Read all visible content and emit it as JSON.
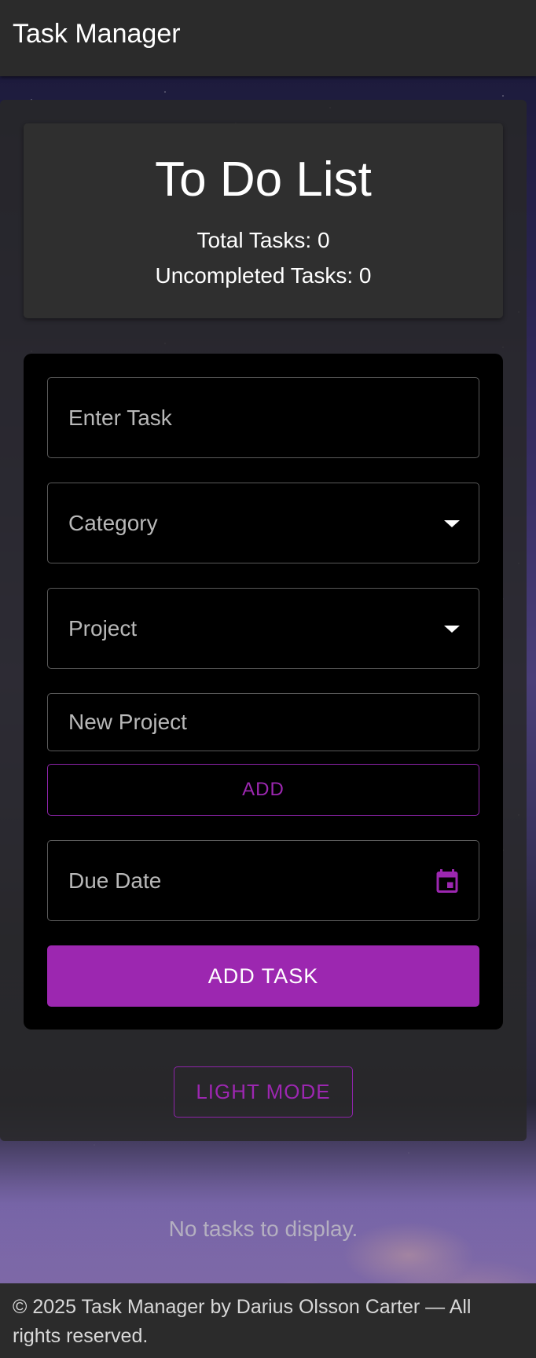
{
  "app": {
    "title": "Task Manager"
  },
  "header": {
    "title": "To Do List",
    "total_tasks": "Total Tasks: 0",
    "uncompleted_tasks": "Uncompleted Tasks: 0"
  },
  "form": {
    "task_placeholder": "Enter Task",
    "category_placeholder": "Category",
    "project_placeholder": "Project",
    "new_project_placeholder": "New Project",
    "add_label": "ADD",
    "due_date_placeholder": "Due Date",
    "add_task_label": "ADD TASK"
  },
  "theme_toggle": {
    "label": "LIGHT MODE"
  },
  "tasks": {
    "empty_message": "No tasks to display."
  },
  "footer": {
    "text": "© 2025 Task Manager by Darius Olsson Carter — All rights reserved."
  },
  "colors": {
    "accent": "#9c27b0",
    "appbar": "#2b2b2b",
    "card": "#2f2f2f"
  },
  "icons": {
    "dropdown": "caret-down-icon",
    "date": "calendar-icon"
  }
}
